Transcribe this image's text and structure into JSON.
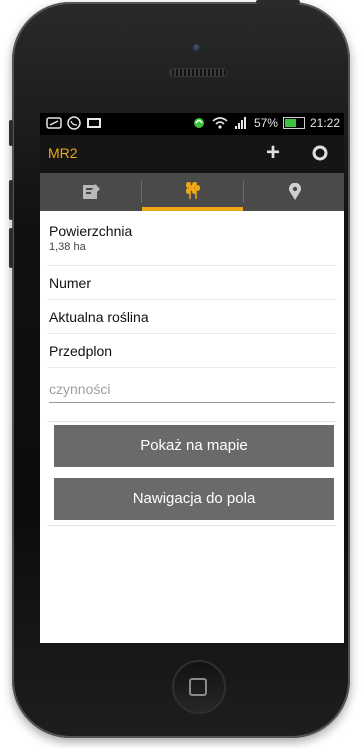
{
  "statusbar": {
    "battery_percent": "57%",
    "time": "21:22",
    "icons": [
      "voicemail-icon",
      "whatsapp-icon",
      "gallery-icon",
      "headset-icon",
      "wifi-icon",
      "signal-icon",
      "battery-icon"
    ],
    "battery_color": "#3cc43c"
  },
  "actionbar": {
    "title": "MR2",
    "title_color": "#f0a818",
    "actions": [
      "plus-icon",
      "gear-icon"
    ]
  },
  "tabs": [
    {
      "icon": "notes-icon",
      "active": false
    },
    {
      "icon": "wheat-icon",
      "active": true
    },
    {
      "icon": "map-pin-icon",
      "active": false
    }
  ],
  "accent_color": "#f0a818",
  "fields": [
    {
      "label": "Powierzchnia",
      "value": "1,38 ha"
    },
    {
      "label": "Numer",
      "value": ""
    },
    {
      "label": "Aktualna roślina",
      "value": ""
    },
    {
      "label": "Przedplon",
      "value": ""
    }
  ],
  "activities": {
    "placeholder": "czynności",
    "value": ""
  },
  "buttons": {
    "show_on_map": "Pokaż na mapie",
    "navigate": "Nawigacja do pola"
  }
}
